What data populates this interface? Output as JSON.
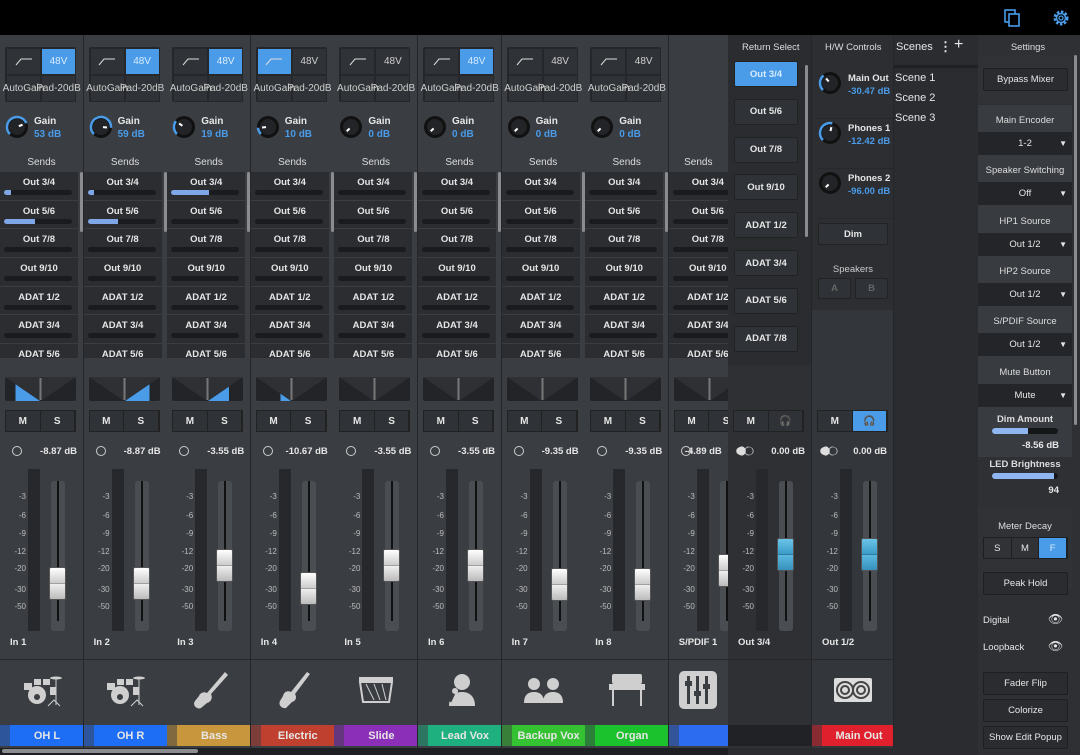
{
  "colors": {
    "accent": "#4a9be8",
    "bg": "#3a3d42",
    "main_out": "#e0202c"
  },
  "topbar": {
    "icons": [
      "copy-icon",
      "gear-icon"
    ]
  },
  "channel_labels": {
    "auto": "Auto",
    "gain": "Gain",
    "pad": "Pad",
    "pad_db": "-20dB",
    "p48": "48V",
    "gain_label": "Gain",
    "sends": "Sends",
    "mute": "M",
    "solo": "S"
  },
  "send_names": [
    "Out  3/4",
    "Out  5/6",
    "Out  7/8",
    "Out  9/10",
    "ADAT  1/2",
    "ADAT  3/4",
    "ADAT  5/6"
  ],
  "scale": [
    "-3",
    "-6",
    "-9",
    "-12",
    "-20",
    "-30",
    "-50"
  ],
  "channels": [
    {
      "input": "In  1",
      "name": "OH L",
      "color": "#1e6ef5",
      "hpf": false,
      "p48": true,
      "gain": "53 dB",
      "gain_frac": 0.75,
      "sends": [
        0.1,
        0.45,
        0,
        0,
        0,
        0,
        0
      ],
      "pan": -0.7,
      "level": "-8.87 dB",
      "db": -8.87,
      "icon": "drums-icon"
    },
    {
      "input": "In  2",
      "name": "OH R",
      "color": "#1e6ef5",
      "hpf": false,
      "p48": true,
      "gain": "59 dB",
      "gain_frac": 0.85,
      "sends": [
        0.1,
        0.45,
        0,
        0,
        0,
        0,
        0
      ],
      "pan": 0.7,
      "level": "-8.87 dB",
      "db": -8.87,
      "icon": "drums-icon"
    },
    {
      "input": "In  3",
      "name": "Bass",
      "color": "#c8963c",
      "hpf": false,
      "p48": true,
      "gain": "19 dB",
      "gain_frac": 0.3,
      "sends": [
        0.55,
        0,
        0,
        0,
        0,
        0,
        0
      ],
      "pan": 0.6,
      "level": "-3.55 dB",
      "db": -3.55,
      "icon": "bass-guitar-icon"
    },
    {
      "input": "In  4",
      "name": "Electric",
      "color": "#c0402f",
      "hpf": true,
      "p48": false,
      "gain": "10 dB",
      "gain_frac": 0.15,
      "sends": [
        0,
        0,
        0,
        0,
        0,
        0,
        0
      ],
      "pan": -0.3,
      "level": "-10.67 dB",
      "db": -10.67,
      "icon": "electric-guitar-icon"
    },
    {
      "input": "In  5",
      "name": "Slide",
      "color": "#8c2fb8",
      "hpf": false,
      "p48": false,
      "gain": "0 dB",
      "gain_frac": 0,
      "sends": [
        0,
        0,
        0,
        0,
        0,
        0,
        0
      ],
      "pan": 0,
      "level": "-3.55 dB",
      "db": -3.55,
      "icon": "lap-steel-icon"
    },
    {
      "input": "In  6",
      "name": "Lead Vox",
      "color": "#1fb07f",
      "hpf": false,
      "p48": true,
      "gain": "0 dB",
      "gain_frac": 0,
      "sends": [
        0,
        0,
        0,
        0,
        0,
        0,
        0
      ],
      "pan": 0,
      "level": "-3.55 dB",
      "db": -3.55,
      "icon": "singer-icon"
    },
    {
      "input": "In  7",
      "name": "Backup Vox",
      "color": "#35c232",
      "hpf": false,
      "p48": false,
      "gain": "0 dB",
      "gain_frac": 0,
      "sends": [
        0,
        0,
        0,
        0,
        0,
        0,
        0
      ],
      "pan": 0,
      "level": "-9.35 dB",
      "db": -9.35,
      "icon": "backup-singers-icon"
    },
    {
      "input": "In  8",
      "name": "Organ",
      "color": "#1cc12e",
      "hpf": false,
      "p48": false,
      "gain": "0 dB",
      "gain_frac": 0,
      "sends": [
        0,
        0,
        0,
        0,
        0,
        0,
        0
      ],
      "pan": 0,
      "level": "-9.35 dB",
      "db": -9.35,
      "icon": "organ-icon"
    },
    {
      "input": "S/PDIF 1",
      "name": "",
      "color": "#2b6cf0",
      "hpf": false,
      "p48": false,
      "gain": null,
      "sends": [
        0,
        0,
        0,
        0,
        0,
        0,
        0
      ],
      "pan": 0,
      "level": "-4.89 dB",
      "db": -4.89,
      "icon": "mixer-icon",
      "partial": true
    }
  ],
  "return_select": {
    "title": "Return Select",
    "items": [
      "Out  3/4",
      "Out  5/6",
      "Out  7/8",
      "Out  9/10",
      "ADAT  1/2",
      "ADAT  3/4",
      "ADAT  5/6",
      "ADAT  7/8"
    ],
    "selected": 0,
    "strip": {
      "mute": "M",
      "level": "0.00 dB",
      "db": 0,
      "name": "Out  3/4"
    }
  },
  "hw": {
    "title": "H/W Controls",
    "knobs": [
      {
        "label": "Main Out",
        "value": "-30.47 dB",
        "frac": 0.35
      },
      {
        "label": "Phones 1",
        "value": "-12.42 dB",
        "frac": 0.55
      },
      {
        "label": "Phones 2",
        "value": "-96.00 dB",
        "frac": 0
      }
    ],
    "dim": "Dim",
    "speakers": "Speakers",
    "a": "A",
    "b": "B",
    "strip": {
      "mute": "M",
      "level": "0.00 dB",
      "db": 0,
      "name": "Out  1/2",
      "label": "Main Out"
    }
  },
  "scenes": {
    "title": "Scenes",
    "items": [
      "Scene 1",
      "Scene 2",
      "Scene 3"
    ]
  },
  "settings": {
    "title": "Settings",
    "bypass": "Bypass Mixer",
    "main_encoder": "Main Encoder",
    "main_encoder_val": "1-2",
    "speaker_switching": "Speaker Switching",
    "speaker_switching_val": "Off",
    "hp1": "HP1 Source",
    "hp1_val": "Out  1/2",
    "hp2": "HP2 Source",
    "hp2_val": "Out  1/2",
    "spdif": "S/PDIF Source",
    "spdif_val": "Out  1/2",
    "mute_button": "Mute Button",
    "mute_button_val": "Mute",
    "dim_amount": "Dim Amount",
    "dim_amount_val": "-8.56 dB",
    "dim_frac": 0.55,
    "led": "LED Brightness",
    "led_val": "94",
    "led_frac": 0.94,
    "meter_decay": "Meter Decay",
    "decay_opts": [
      "S",
      "M",
      "F"
    ],
    "decay_sel": 2,
    "peak_hold": "Peak Hold",
    "digital": "Digital",
    "loopback": "Loopback",
    "fader_flip": "Fader Flip",
    "colorize": "Colorize",
    "show_edit": "Show Edit Popup"
  }
}
